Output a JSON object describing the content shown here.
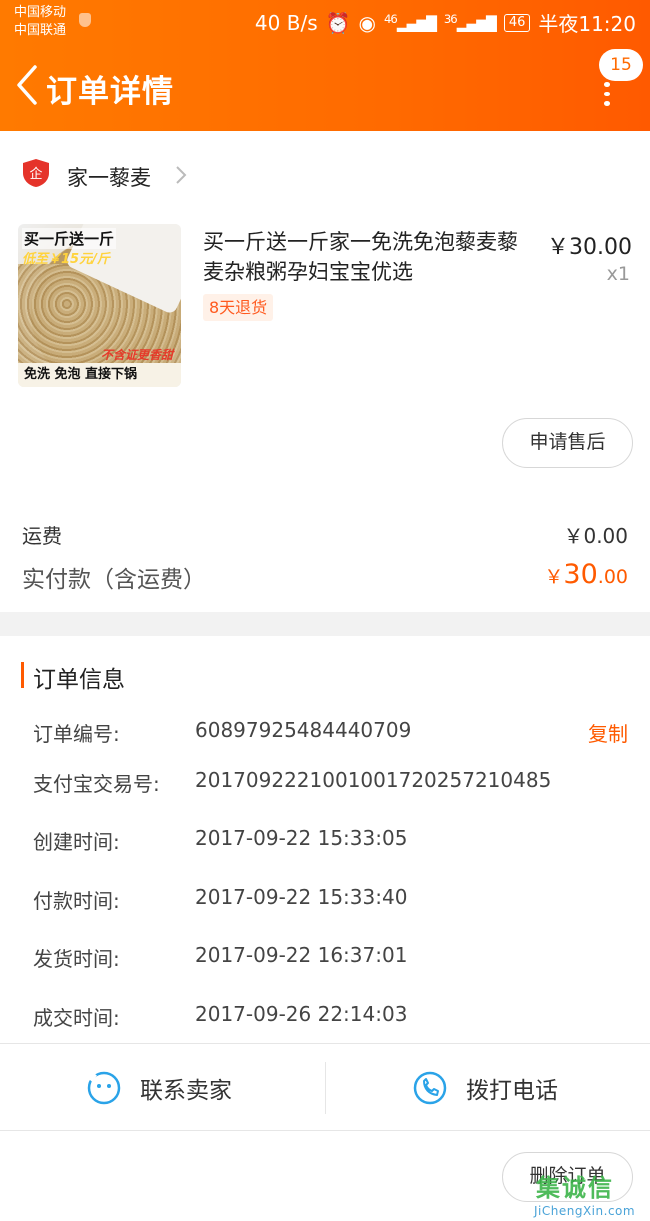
{
  "status_bar": {
    "carrier1": "中国移动",
    "carrier2": "中国联通",
    "speed": "40 B/s",
    "signal1": "46",
    "signal2": "36",
    "battery": "46",
    "time": "半夜11:20"
  },
  "header": {
    "title": "订单详情",
    "badge_count": "15"
  },
  "shop": {
    "badge": "企",
    "name": "家一藜麦"
  },
  "product": {
    "title": "买一斤送一斤家一免洗免泡藜麦藜麦杂粮粥孕妇宝宝优选",
    "price": "￥30.00",
    "quantity": "x1",
    "return_tag": "8天退货",
    "thumb_text1": "买一斤送一斤",
    "thumb_text2": "低至￥15元/斤",
    "thumb_text3": "不含证更香甜",
    "thumb_text4": "免洗 免泡 直接下锅",
    "after_sale_label": "申请售后"
  },
  "fees": {
    "shipping_label": "运费",
    "shipping_value": "￥0.00",
    "paid_label": "实付款（含运费）",
    "paid_currency": "￥",
    "paid_int": "30",
    "paid_dec": ".00"
  },
  "order_info": {
    "section_title": "订单信息",
    "copy_label": "复制",
    "rows": [
      {
        "label": "订单编号:",
        "value": "60897925484440709"
      },
      {
        "label": "支付宝交易号:",
        "value": "2017092221001001720257210485"
      },
      {
        "label": "创建时间:",
        "value": "2017-09-22 15:33:05"
      },
      {
        "label": "付款时间:",
        "value": "2017-09-22 15:33:40"
      },
      {
        "label": "发货时间:",
        "value": "2017-09-22 16:37:01"
      },
      {
        "label": "成交时间:",
        "value": "2017-09-26 22:14:03"
      }
    ]
  },
  "actions": {
    "contact_label": "联系卖家",
    "call_label": "拨打电话",
    "delete_label": "删除订单"
  },
  "watermark": {
    "logo": "集诚信",
    "url": "JiChengXin.com"
  },
  "colors": {
    "accent": "#ff6a00",
    "price_accent": "#ff5a00",
    "icon_blue": "#2aa3e8",
    "shop_badge": "#e5332a"
  }
}
